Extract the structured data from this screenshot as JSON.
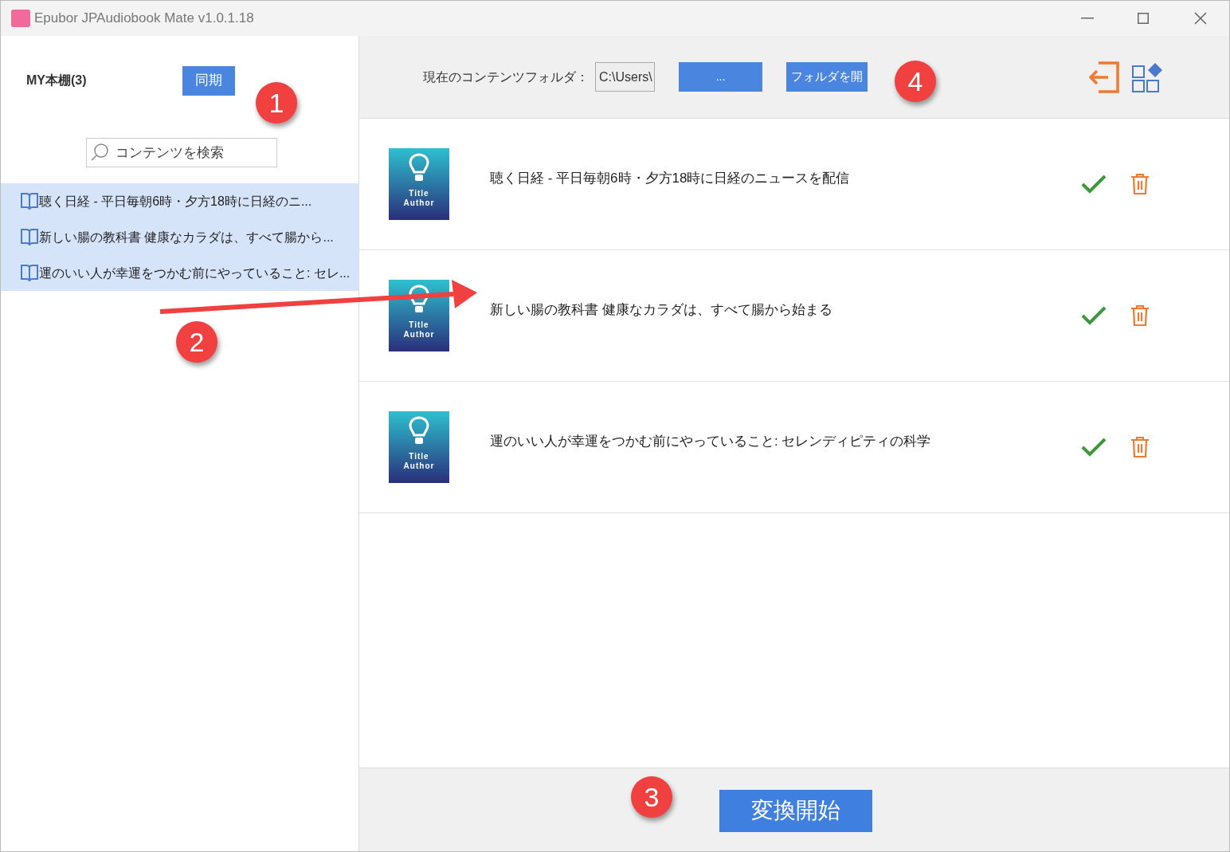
{
  "window": {
    "title": "Epubor JPAudiobook Mate v1.0.1.18"
  },
  "sidebar": {
    "heading": "MY本棚(3)",
    "sync_button": "同期",
    "search": {
      "placeholder": "コンテンツを検索"
    },
    "items": [
      {
        "label": "聴く日経 - 平日毎朝6時・夕方18時に日経のニ...",
        "selected": true
      },
      {
        "label": "新しい腸の教科書 健康なカラダは、すべて腸から...",
        "selected": true
      },
      {
        "label": "運のいい人が幸運をつかむ前にやっていること: セレ...",
        "selected": true
      }
    ]
  },
  "toolbar": {
    "folder_label": "現在のコンテンツフォルダ：",
    "folder_value": "C:\\Users\\",
    "browse_button": "...",
    "open_button": "フォルダを開"
  },
  "books": [
    {
      "title": "聴く日経 - 平日毎朝6時・夕方18時に日経のニュースを配信",
      "cover_title": "Title",
      "cover_author": "Author",
      "done": true
    },
    {
      "title": "新しい腸の教科書 健康なカラダは、すべて腸から始まる",
      "cover_title": "Title",
      "cover_author": "Author",
      "done": true
    },
    {
      "title": "運のいい人が幸運をつかむ前にやっていること: セレンディピティの科学",
      "cover_title": "Title",
      "cover_author": "Author",
      "done": true
    }
  ],
  "convert_button": "変換開始",
  "callouts": [
    "1",
    "2",
    "3",
    "4"
  ]
}
